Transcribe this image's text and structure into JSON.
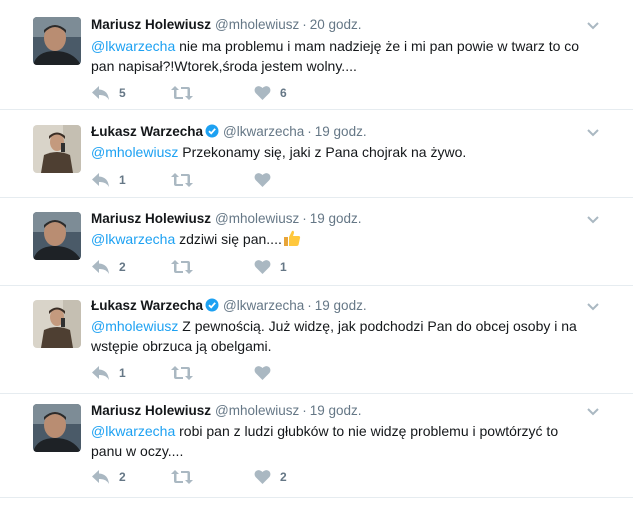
{
  "tweets": [
    {
      "author": "Mariusz Holewiusz",
      "handle": "@mholewiusz",
      "time": "20 godz.",
      "verified": false,
      "mention": "@lkwarzecha",
      "text": " nie ma problemu i mam nadzieję że i mi pan powie w twarz to co pan napisał?!Wtorek,środa jestem wolny....",
      "replies": "5",
      "retweets": "",
      "likes": "6"
    },
    {
      "author": "Łukasz Warzecha",
      "handle": "@lkwarzecha",
      "time": "19 godz.",
      "verified": true,
      "mention": "@mholewiusz",
      "text": " Przekonamy się, jaki z Pana chojrak na żywo.",
      "replies": "1",
      "retweets": "",
      "likes": ""
    },
    {
      "author": "Mariusz Holewiusz",
      "handle": "@mholewiusz",
      "time": "19 godz.",
      "verified": false,
      "mention": "@lkwarzecha",
      "text": " zdziwi się pan....",
      "emoji": "thumbs-up-emoji",
      "replies": "2",
      "retweets": "",
      "likes": "1"
    },
    {
      "author": "Łukasz Warzecha",
      "handle": "@lkwarzecha",
      "time": "19 godz.",
      "verified": true,
      "mention": "@mholewiusz",
      "text": " Z pewnością. Już widzę, jak podchodzi Pan do obcej osoby i na wstępie obrzuca ją obelgami.",
      "replies": "1",
      "retweets": "",
      "likes": ""
    },
    {
      "author": "Mariusz Holewiusz",
      "handle": "@mholewiusz",
      "time": "19 godz.",
      "verified": false,
      "mention": "@lkwarzecha",
      "text": " robi pan z ludzi głubków to nie widzę problemu i powtórzyć to panu w oczy....",
      "replies": "2",
      "retweets": "",
      "likes": "2"
    }
  ],
  "colors": {
    "link": "#1da1f2",
    "muted": "#657786",
    "divider": "#e6ecf0",
    "verified": "#1da1f2"
  },
  "icons": [
    "reply-icon",
    "retweet-icon",
    "like-icon",
    "chevron-down-icon",
    "verified-badge-icon"
  ]
}
